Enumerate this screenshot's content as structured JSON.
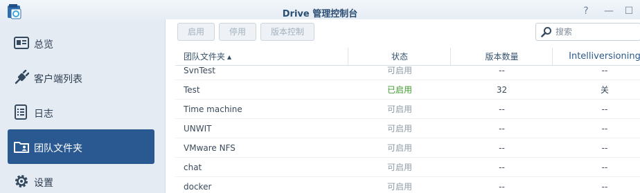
{
  "window": {
    "title": "Drive 管理控制台",
    "help_glyph": "?",
    "minimize_glyph": "—",
    "maximize_glyph": "☐"
  },
  "sidebar": {
    "items": [
      {
        "label": "总览",
        "icon": "overview-card-icon",
        "active": false
      },
      {
        "label": "客户端列表",
        "icon": "plug-icon",
        "active": false
      },
      {
        "label": "日志",
        "icon": "log-list-icon",
        "active": false
      },
      {
        "label": "团队文件夹",
        "icon": "team-folder-icon",
        "active": true
      },
      {
        "label": "设置",
        "icon": "gear-icon",
        "active": false
      }
    ]
  },
  "toolbar": {
    "enable_label": "启用",
    "disable_label": "停用",
    "version_control_label": "版本控制",
    "search_placeholder": "搜索"
  },
  "table": {
    "headers": {
      "name": "团队文件夹",
      "sort_indicator": "▲",
      "status": "状态",
      "versions": "版本数量",
      "intelliversioning": "Intelliversioning"
    },
    "rows": [
      {
        "name": "SvnTest",
        "status": "可启用",
        "enabled": false,
        "versions": "--",
        "intelli": "--"
      },
      {
        "name": "Test",
        "status": "已启用",
        "enabled": true,
        "versions": "32",
        "intelli": "关"
      },
      {
        "name": "Time machine",
        "status": "可启用",
        "enabled": false,
        "versions": "--",
        "intelli": "--"
      },
      {
        "name": "UNWIT",
        "status": "可启用",
        "enabled": false,
        "versions": "--",
        "intelli": "--"
      },
      {
        "name": "VMware NFS",
        "status": "可启用",
        "enabled": false,
        "versions": "--",
        "intelli": "--"
      },
      {
        "name": "chat",
        "status": "可启用",
        "enabled": false,
        "versions": "--",
        "intelli": "--"
      },
      {
        "name": "docker",
        "status": "可启用",
        "enabled": false,
        "versions": "--",
        "intelli": "--"
      }
    ]
  },
  "colors": {
    "accent": "#2a5991",
    "enabled_status": "#3e9a2e",
    "available_status": "#8e9aa6",
    "title": "#2a4d73"
  }
}
